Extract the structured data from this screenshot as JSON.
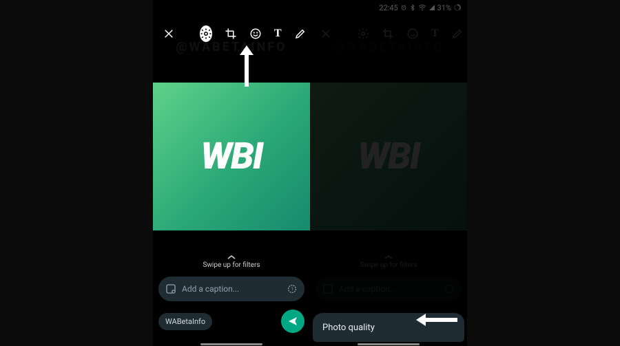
{
  "status": {
    "time": "22:45",
    "battery_text": "31%"
  },
  "watermark": "@WABETAINFO",
  "preview_logo": "WBI",
  "swipe_hint": "Swipe up for filters",
  "caption": {
    "placeholder": "Add a caption..."
  },
  "recipient_chip": "WABetaInfo",
  "sheet": {
    "title": "Photo quality"
  },
  "icons": {
    "close": "close-icon",
    "gear": "gear-icon",
    "crop": "crop-icon",
    "emoji": "emoji-icon",
    "text": "text-icon",
    "draw": "draw-icon",
    "sticker": "sticker-icon",
    "timer": "timer-icon",
    "send": "send-icon"
  }
}
